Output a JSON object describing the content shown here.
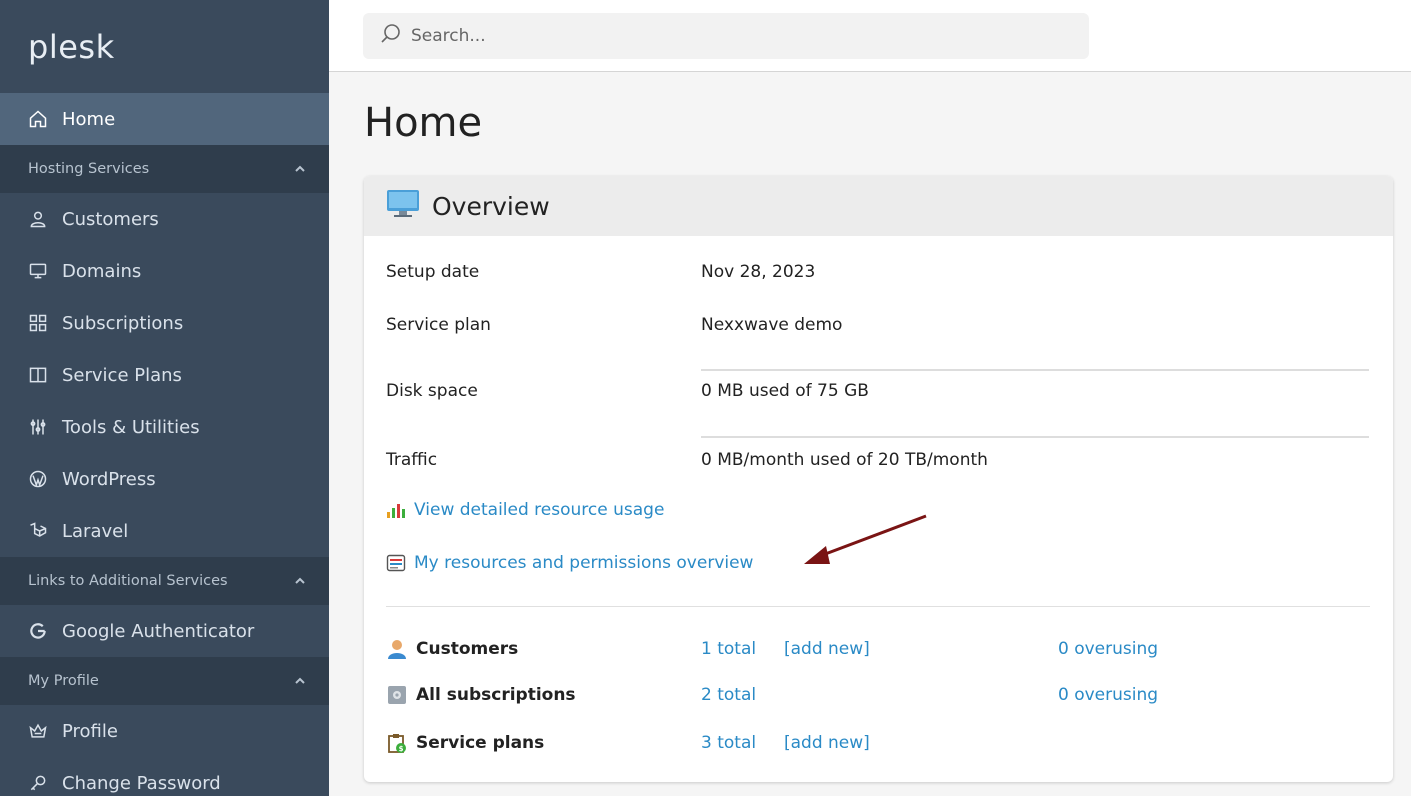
{
  "sidebar": {
    "logo": "plesk",
    "items": [
      {
        "label": "Home",
        "icon": "home-icon"
      },
      {
        "section": "Hosting Services"
      },
      {
        "label": "Customers",
        "icon": "user-icon"
      },
      {
        "label": "Domains",
        "icon": "monitor-icon"
      },
      {
        "label": "Subscriptions",
        "icon": "grid-icon"
      },
      {
        "label": "Service Plans",
        "icon": "book-icon"
      },
      {
        "label": "Tools & Utilities",
        "icon": "sliders-icon"
      },
      {
        "label": "WordPress",
        "icon": "wordpress-icon"
      },
      {
        "label": "Laravel",
        "icon": "laravel-icon"
      },
      {
        "section": "Links to Additional Services"
      },
      {
        "label": "Google Authenticator",
        "icon": "google-icon"
      },
      {
        "section": "My Profile"
      },
      {
        "label": "Profile",
        "icon": "crown-icon"
      },
      {
        "label": "Change Password",
        "icon": "key-icon"
      }
    ]
  },
  "search": {
    "placeholder": "Search..."
  },
  "page": {
    "title": "Home"
  },
  "overview": {
    "title": "Overview",
    "rows": [
      {
        "label": "Setup date",
        "value": "Nov 28, 2023"
      },
      {
        "label": "Service plan",
        "value": "Nexxwave demo"
      },
      {
        "label": "Disk space",
        "value": "0 MB used of 75 GB"
      },
      {
        "label": "Traffic",
        "value": "0 MB/month used of 20 TB/month"
      }
    ],
    "links": {
      "resource_usage": "View detailed resource usage",
      "permissions": "My resources and permissions overview"
    },
    "stats": [
      {
        "label": "Customers",
        "total": "1 total",
        "add": "[add new]",
        "overusing": "0 overusing"
      },
      {
        "label": "All subscriptions",
        "total": "2 total",
        "overusing": "0 overusing"
      },
      {
        "label": "Service plans",
        "total": "3 total",
        "add": "[add new]"
      }
    ]
  },
  "colors": {
    "sidebar": "#3a4a5c",
    "active": "#51667c",
    "section": "#2f3d4c",
    "link": "#2a8ac6",
    "arrow": "#7a1414"
  }
}
